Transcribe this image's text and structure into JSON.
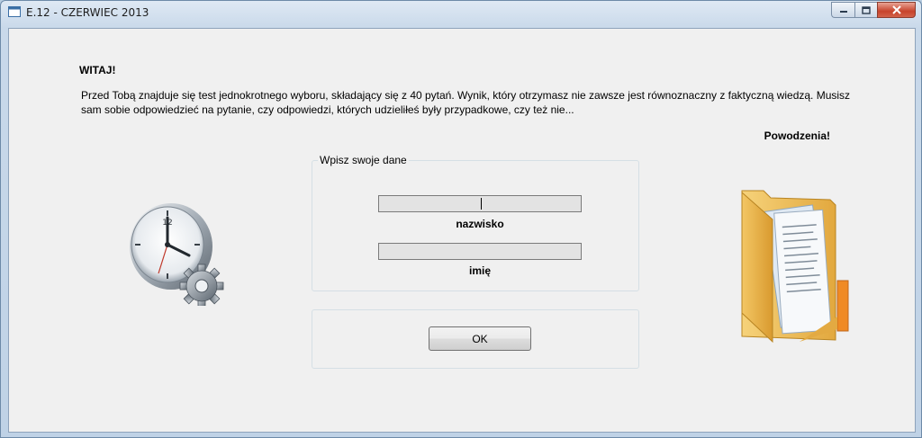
{
  "window": {
    "title": "E.12 - CZERWIEC 2013"
  },
  "content": {
    "heading": "WITAJ!",
    "intro": "Przed Tobą znajduje się test jednokrotnego wyboru, składający się z 40 pytań. Wynik, który otrzymasz nie zawsze jest równoznaczny z faktyczną wiedzą. Musisz sam sobie odpowiedzieć na pytanie, czy odpowiedzi, których udzieliłeś były przypadkowe, czy też nie...",
    "good_luck": "Powodzenia!"
  },
  "form": {
    "group_title": "Wpisz swoje dane",
    "surname_value": "",
    "surname_label": "nazwisko",
    "name_value": "",
    "name_label": "imię",
    "ok_label": "OK"
  },
  "icons": {
    "left": "clock-gear-icon",
    "right": "folder-documents-icon",
    "window": "app-window-icon"
  }
}
